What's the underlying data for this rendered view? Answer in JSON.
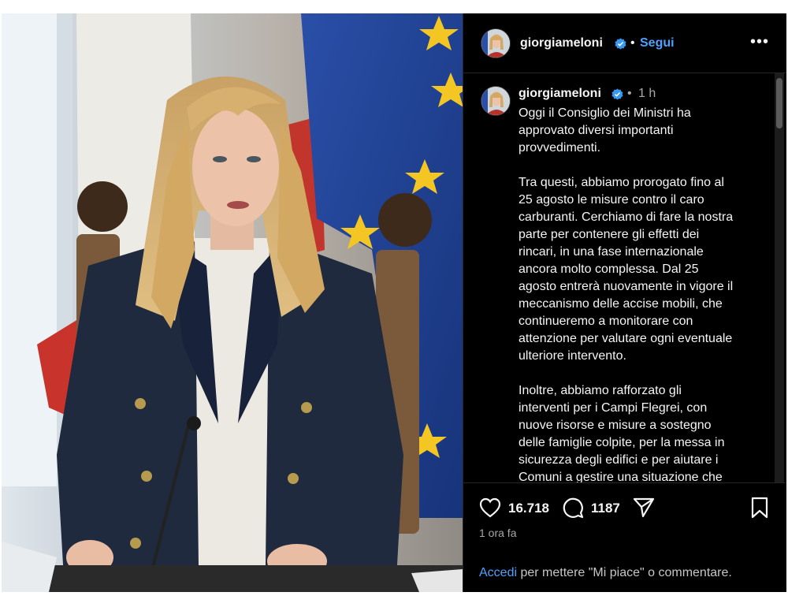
{
  "post": {
    "username": "giorgiameloni",
    "follow_label": "Segui",
    "separator": "•",
    "more_label": "•••",
    "caption_time": "1 h",
    "caption_paragraphs": [
      "Oggi il Consiglio dei Ministri ha approvato diversi importanti provvedimenti.",
      "Tra questi, abbiamo prorogato fino al 25 agosto le misure contro il caro carburanti. Cerchiamo di fare la nostra parte per contenere gli effetti dei rincari, in una fase internazionale ancora molto complessa. Dal 25 agosto entrerà nuovamente in vigore il meccanismo delle accise mobili, che continueremo a monitorare con attenzione per valutare ogni eventuale ulteriore intervento.",
      "Inoltre, abbiamo rafforzato gli interventi per i Campi Flegrei, con nuove risorse e misure a sostegno delle famiglie colpite, per la messa in sicurezza degli edifici e per aiutare i Comuni a gestire una situazione che"
    ],
    "caption_display": "Oggi il Consiglio dei Ministri ha\napprovato diversi importanti\nprovvedimenti.\n\nTra questi, abbiamo prorogato fino al\n25 agosto le misure contro il caro\ncarburanti. Cerchiamo di fare la nostra\nparte per contenere gli effetti dei\nrincari, in una fase internazionale\nancora molto complessa. Dal 25\nagosto entrerà nuovamente in vigore il\nmeccanismo delle accise mobili, che\ncontinueremo a monitorare con\nattenzione per valutare ogni eventuale\nulteriore intervento.\n\nInoltre, abbiamo rafforzato gli\ninterventi per i Campi Flegrei, con\nnuove risorse e misure a sostegno\ndelle famiglie colpite, per la messa in\nsicurezza degli edifici e per aiutare i\nComuni a gestire una situazione che",
    "likes": "16.718",
    "comments": "1187",
    "posted_ago": "1 ora fa",
    "footer_login": "Accedi",
    "footer_text": " per mettere \"Mi piace\" o commentare."
  },
  "icons": {
    "verified": "verified-badge-icon",
    "like": "heart-icon",
    "comment": "comment-bubble-icon",
    "share": "send-icon",
    "save": "bookmark-icon",
    "more": "more-dots-icon"
  },
  "colors": {
    "panel_bg": "#000000",
    "text": "#f5f5f5",
    "muted": "#a8a8a8",
    "link": "#4ca3ff",
    "verified": "#3897f0"
  }
}
